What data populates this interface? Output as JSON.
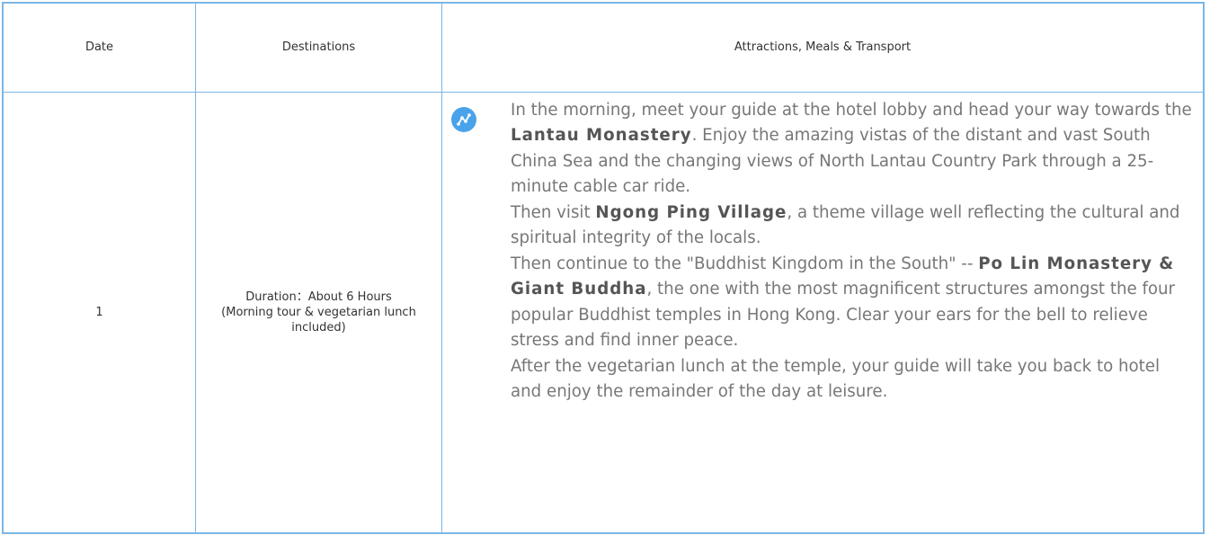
{
  "table": {
    "headers": {
      "date": "Date",
      "destinations": "Destinations",
      "attractions": "Attractions, Meals & Transport"
    },
    "row1": {
      "date": "1",
      "destination_line1": "Duration：About 6 Hours",
      "destination_line2": "(Morning tour & vegetarian lunch included)",
      "icon": "route-icon",
      "para1_before": "In the morning, meet your guide at the hotel lobby and head your way towards the ",
      "para1_bold": "Lantau Monastery",
      "para1_after": ". Enjoy the amazing vistas of the distant and vast South China Sea and the changing views of North Lantau Country Park through a 25-minute cable car ride.",
      "para2_before": "Then visit ",
      "para2_bold": "Ngong Ping Village",
      "para2_after": ", a theme village well reflecting the cultural and spiritual integrity of the locals.",
      "para3_before": "Then continue to the \"Buddhist Kingdom in the South\" -- ",
      "para3_bold": "Po Lin Monastery & Giant Buddha",
      "para3_after": ", the one with the most magnificent structures amongst the four popular Buddhist temples in Hong Kong. Clear your ears for the bell to relieve stress and find inner peace.",
      "para4": "After the vegetarian lunch at the temple, your guide will take you back to hotel and enjoy the remainder of the day at leisure."
    }
  },
  "colors": {
    "border": "#7ab7e6",
    "icon_bg": "#4aa3ea",
    "body_text": "#777777"
  }
}
